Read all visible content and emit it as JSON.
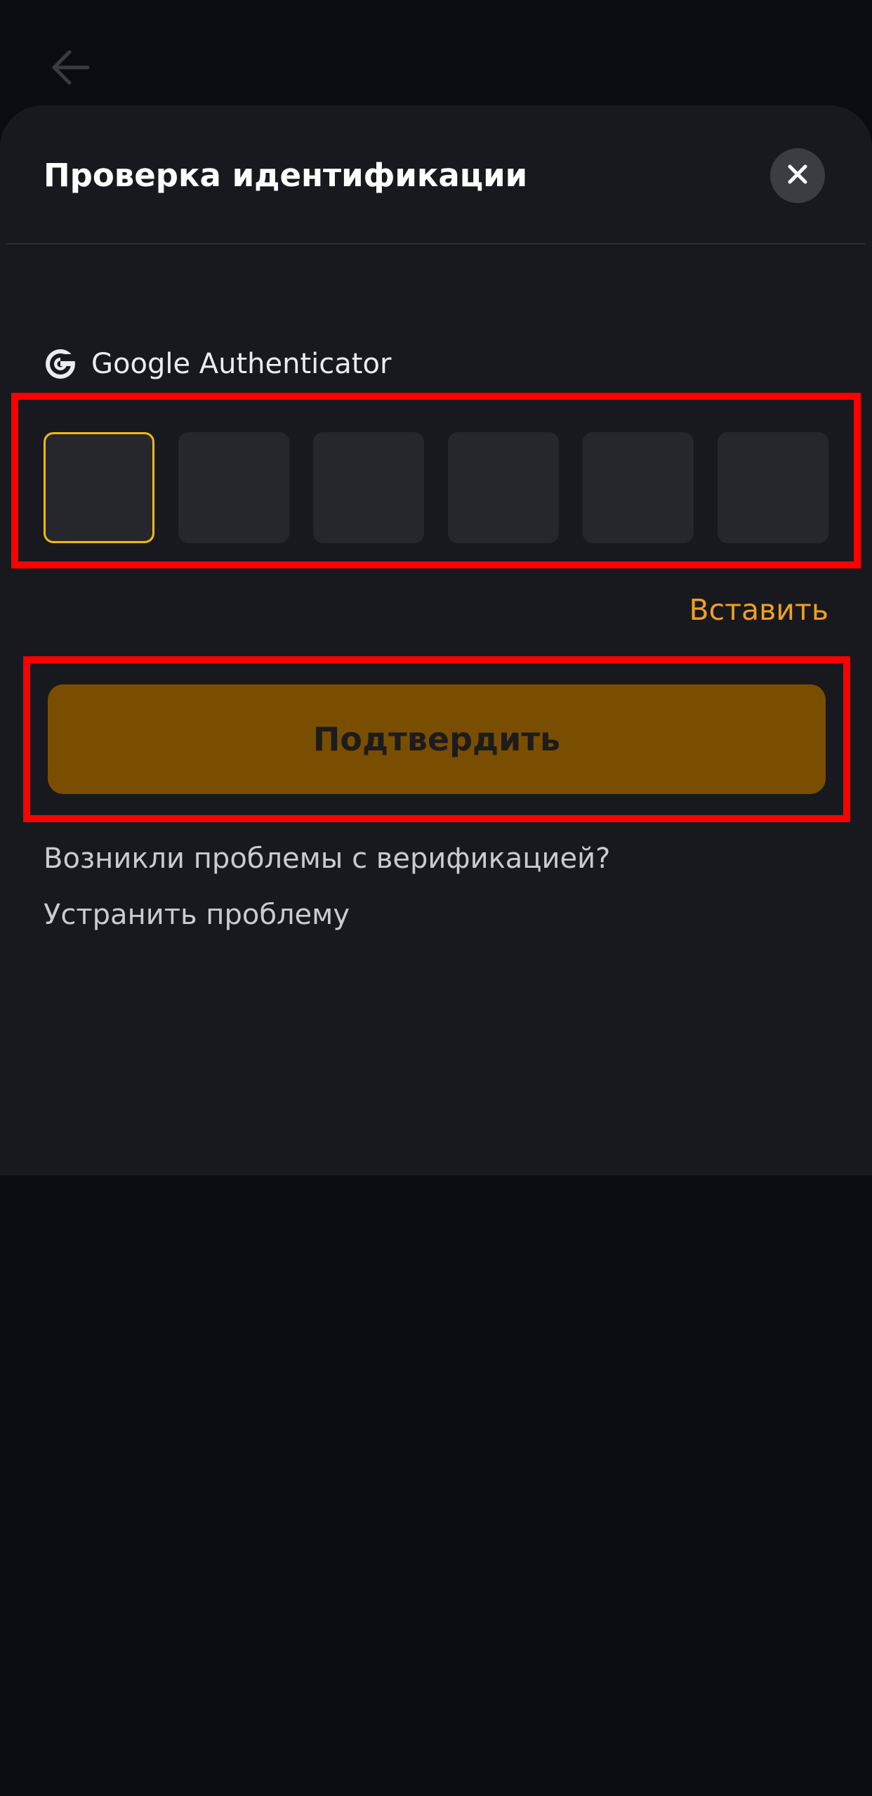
{
  "header": {
    "back_icon": "arrow-left-icon"
  },
  "sheet": {
    "title": "Проверка идентификации",
    "close_icon": "close-icon"
  },
  "authenticator": {
    "icon": "google-g-icon",
    "label": "Google Authenticator",
    "code_length": 6,
    "active_cell_index": 0
  },
  "actions": {
    "paste_label": "Вставить",
    "confirm_label": "Подтвердить"
  },
  "help": {
    "question": "Возникли проблемы с верификацией?",
    "fix_label": "Устранить проблему"
  },
  "colors": {
    "background": "#0b0b12",
    "sheet": "#18191e",
    "accent": "#f0b90b",
    "link": "#f0a020",
    "confirm_button": "#7a4e00",
    "highlight": "#ff0000"
  }
}
